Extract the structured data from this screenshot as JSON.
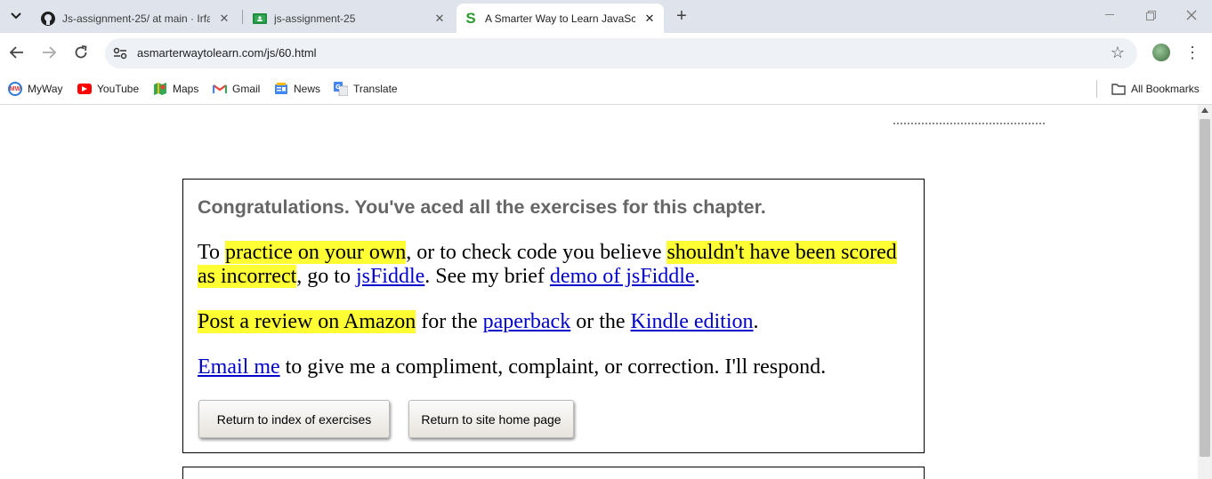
{
  "tabs": [
    {
      "title": "Js-assignment-25/ at main · Irfa",
      "favicon": "github-icon"
    },
    {
      "title": "js-assignment-25",
      "favicon": "google-classroom-icon"
    },
    {
      "title": "A Smarter Way to Learn JavaScr",
      "favicon": "smarter-way-s-icon"
    }
  ],
  "address_bar": {
    "url": "asmarterwaytolearn.com/js/60.html"
  },
  "bookmarks": [
    {
      "label": "MyWay"
    },
    {
      "label": "YouTube"
    },
    {
      "label": "Maps"
    },
    {
      "label": "Gmail"
    },
    {
      "label": "News"
    },
    {
      "label": "Translate"
    }
  ],
  "all_bookmarks_label": "All Bookmarks",
  "page": {
    "heading": "Congratulations. You've aced all the exercises for this chapter.",
    "p1": {
      "t1": "To ",
      "h1": "practice on your own",
      "t2": ", or to check code you believe ",
      "h2": "shouldn't have been scored as incorrect",
      "t3": ", go to ",
      "l1": "jsFiddle",
      "t4": ". See my brief ",
      "l2": "demo of jsFiddle",
      "t5": "."
    },
    "p2": {
      "h1": "Post a review on Amazon",
      "t1": " for the ",
      "l1": "paperback",
      "t2": " or the ",
      "l2": "Kindle edition",
      "t3": "."
    },
    "p3": {
      "l1": "Email me",
      "t1": " to give me a compliment, complaint, or correction. I'll respond."
    },
    "buttons": {
      "index": "Return to index of exercises",
      "home": "Return to site home page"
    }
  },
  "colors": {
    "highlight": "#ffff33",
    "link": "#0000cc",
    "heading": "#666666"
  }
}
